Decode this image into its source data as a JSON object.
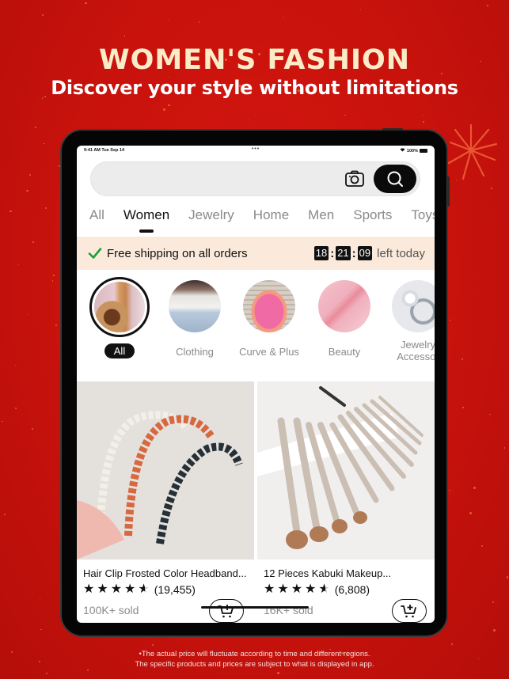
{
  "hero": {
    "title": "WOMEN'S FASHION",
    "subtitle": "Discover your style without limitations"
  },
  "status_bar": {
    "time": "9:41 AM  Tue Sep 14",
    "battery": "100%"
  },
  "search": {
    "value": "",
    "placeholder": "",
    "camera_icon": "camera-icon",
    "search_icon": "search-icon"
  },
  "tabs": [
    {
      "label": "All",
      "active": false
    },
    {
      "label": "Women",
      "active": true
    },
    {
      "label": "Jewelry",
      "active": false
    },
    {
      "label": "Home",
      "active": false
    },
    {
      "label": "Men",
      "active": false
    },
    {
      "label": "Sports",
      "active": false
    },
    {
      "label": "Toys",
      "active": false
    }
  ],
  "shipping": {
    "text": "Free shipping on all orders",
    "countdown": {
      "hours": "18",
      "minutes": "21",
      "seconds": "09",
      "label": "left today"
    }
  },
  "categories": [
    {
      "label": "All",
      "active": true
    },
    {
      "label": "Clothing",
      "active": false
    },
    {
      "label": "Curve & Plus",
      "active": false
    },
    {
      "label": "Beauty",
      "active": false
    },
    {
      "label": "Jewelry & Accessories",
      "line1": "Jewelry",
      "line2": "Accessor",
      "active": false
    }
  ],
  "products": [
    {
      "title": "Hair Clip Frosted Color Headband...",
      "rating": 4.5,
      "reviews": "(19,455)",
      "sold": "100K+ sold"
    },
    {
      "title": "12 Pieces Kabuki Makeup...",
      "rating": 4.5,
      "reviews": "(6,808)",
      "sold": "16K+ sold"
    }
  ],
  "disclaimer": {
    "line1": "•The actual price will fluctuate according to time and different regions.",
    "line2": "The specific products and prices are subject to what is displayed in app."
  },
  "colors": {
    "background_red": "#c8120c",
    "title_cream": "#fbecc8",
    "ship_bar": "#fbeadb",
    "check_green": "#1f9d3a",
    "accent_black": "#111111"
  }
}
